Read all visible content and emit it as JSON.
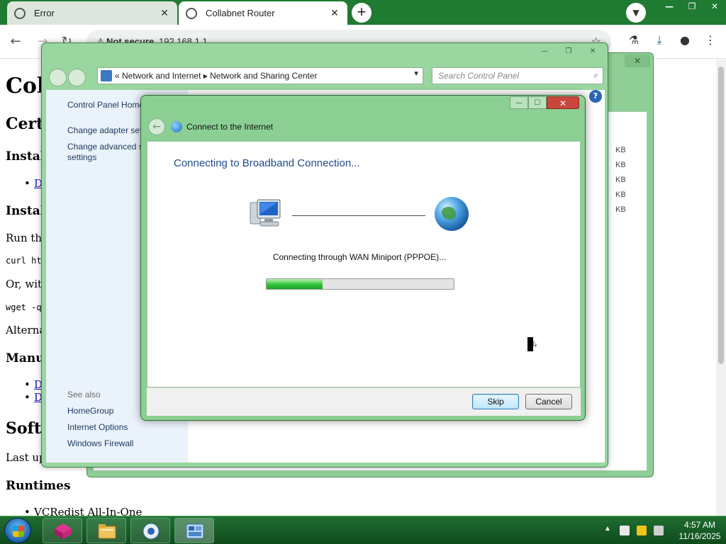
{
  "browser": {
    "tabs": [
      {
        "title": "Error"
      },
      {
        "title": "Collabnet Router"
      }
    ],
    "omnibox": {
      "security": "Not secure",
      "url": "192.168.1.1"
    }
  },
  "page": {
    "heading": "Col",
    "lines": [
      {
        "kind": "h2",
        "text": "Certi"
      },
      {
        "kind": "h3",
        "text": "Install"
      },
      {
        "kind": "li",
        "text": "D"
      },
      {
        "kind": "h3",
        "text": "Install"
      },
      {
        "kind": "p",
        "text": "Run the"
      },
      {
        "kind": "code",
        "text": "curl ht"
      },
      {
        "kind": "p",
        "text": "Or, with"
      },
      {
        "kind": "code",
        "text": "wget -q"
      },
      {
        "kind": "p",
        "text": "Alternat"
      },
      {
        "kind": "h3",
        "text": "Manu"
      },
      {
        "kind": "li",
        "text": "D"
      },
      {
        "kind": "li",
        "text": "D"
      },
      {
        "kind": "h2",
        "text": "Softv"
      },
      {
        "kind": "p",
        "text": "Last upo"
      },
      {
        "kind": "h3",
        "text": "Runtimes"
      },
      {
        "kind": "li_plain",
        "text": "VCRedist All-In-One"
      }
    ]
  },
  "explorer_bg": {
    "sizes": [
      "KB",
      "KB",
      "KB",
      "KB",
      "KB"
    ]
  },
  "nsc": {
    "breadcrumbs": [
      "Network and Internet",
      "Network and Sharing Center"
    ],
    "search_placeholder": "Search Control Panel",
    "sidebar": {
      "items": [
        "Control Panel Home",
        "Change adapter settings",
        "Change advanced sharing",
        "settings"
      ],
      "see_also_label": "See also",
      "see_also": [
        "HomeGroup",
        "Internet Options",
        "Windows Firewall"
      ]
    }
  },
  "dialog": {
    "title": "Connect to the Internet",
    "heading": "Connecting to Broadband Connection...",
    "status": "Connecting through WAN Miniport (PPPOE)...",
    "progress": 0.3,
    "buttons": {
      "skip": "Skip",
      "cancel": "Cancel"
    }
  },
  "taskbar": {
    "time": "4:57 AM",
    "date": "11/16/2025"
  },
  "colors": {
    "aero": "#8ccf93",
    "taskbar": "#1f6e31",
    "link": "#1a0dab",
    "dialog_heading": "#1e4b8c"
  }
}
